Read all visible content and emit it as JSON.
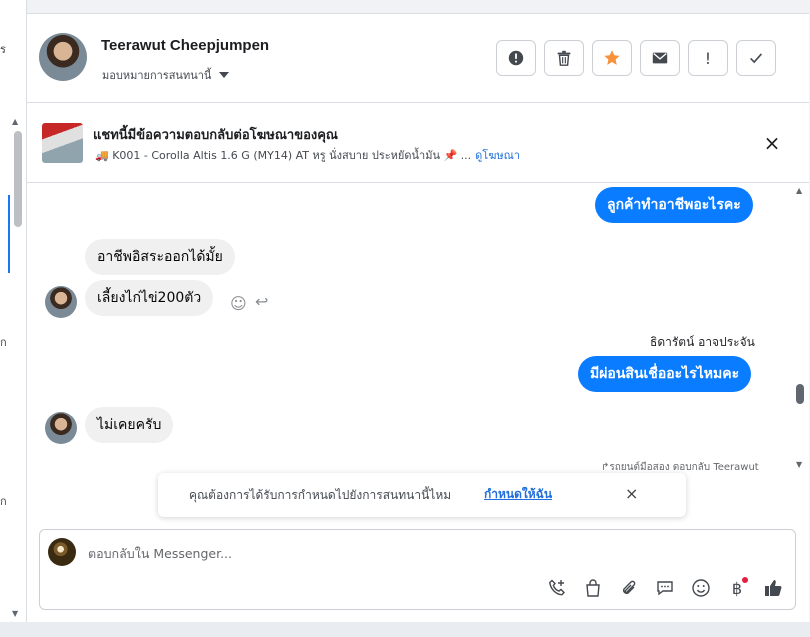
{
  "left_strip": {
    "fragments": [
      "ร",
      "ก",
      "ก"
    ]
  },
  "header": {
    "contact_name": "Teerawut Cheepjumpen",
    "assign_label": "มอบหมายการสนทนานี้",
    "actions": [
      {
        "name": "spam-button",
        "icon": "alert-circle-icon",
        "glyph": "!"
      },
      {
        "name": "delete-button",
        "icon": "trash-icon",
        "glyph": ""
      },
      {
        "name": "star-button",
        "icon": "star-icon",
        "glyph": "★",
        "color": "#f7923a"
      },
      {
        "name": "email-button",
        "icon": "envelope-icon",
        "glyph": ""
      },
      {
        "name": "important-button",
        "icon": "exclamation-icon",
        "glyph": "!"
      },
      {
        "name": "done-button",
        "icon": "check-icon",
        "glyph": "✓"
      }
    ]
  },
  "ad_bar": {
    "title": "แชทนี้มีข้อความตอบกลับต่อโฆษณาของคุณ",
    "description": "🚚 K001 - Corolla Altis 1.6 G (MY14) AT หรู นั่งสบาย ประหยัดน้ำมัน 📌 ...",
    "link": "ดูโฆษณา",
    "close": "×"
  },
  "conversation": {
    "messages": [
      {
        "direction": "out",
        "text": "ลูกค้าทำอาชีพอะไรคะ"
      },
      {
        "direction": "in",
        "text": "อาชีพอิสระออกได้มั้ย"
      },
      {
        "direction": "in",
        "text": "เลี้ยงไก่ไข่200ตัว"
      },
      {
        "direction": "out",
        "sender": "ธิดารัตน์ อาจประจัน",
        "text": "มีผ่อนสินเชื่ออะไรไหมคะ"
      },
      {
        "direction": "in",
        "text": "ไม่เคยครับ"
      }
    ],
    "reaction_icons": [
      "☺",
      "↩"
    ],
    "reply_note": "↱รถยนต์มือสอง ตอบกลับ Teerawut"
  },
  "assign_banner": {
    "text": "คุณต้องการได้รับการกำหนดไปยังการสนทนานี้ไหม",
    "link": "กำหนดให้ฉัน",
    "close": "×"
  },
  "composer": {
    "placeholder": "ตอบกลับใน Messenger...",
    "tools": [
      "call-add-icon",
      "shopping-bag-icon",
      "paperclip-icon",
      "saved-reply-icon",
      "emoji-icon",
      "baht-icon",
      "thumbs-up-icon"
    ],
    "baht_glyph": "฿"
  },
  "colors": {
    "accent": "#0a7cff",
    "link": "#216fdb",
    "star": "#f7923a",
    "notification_dot": "#e41e3f"
  }
}
